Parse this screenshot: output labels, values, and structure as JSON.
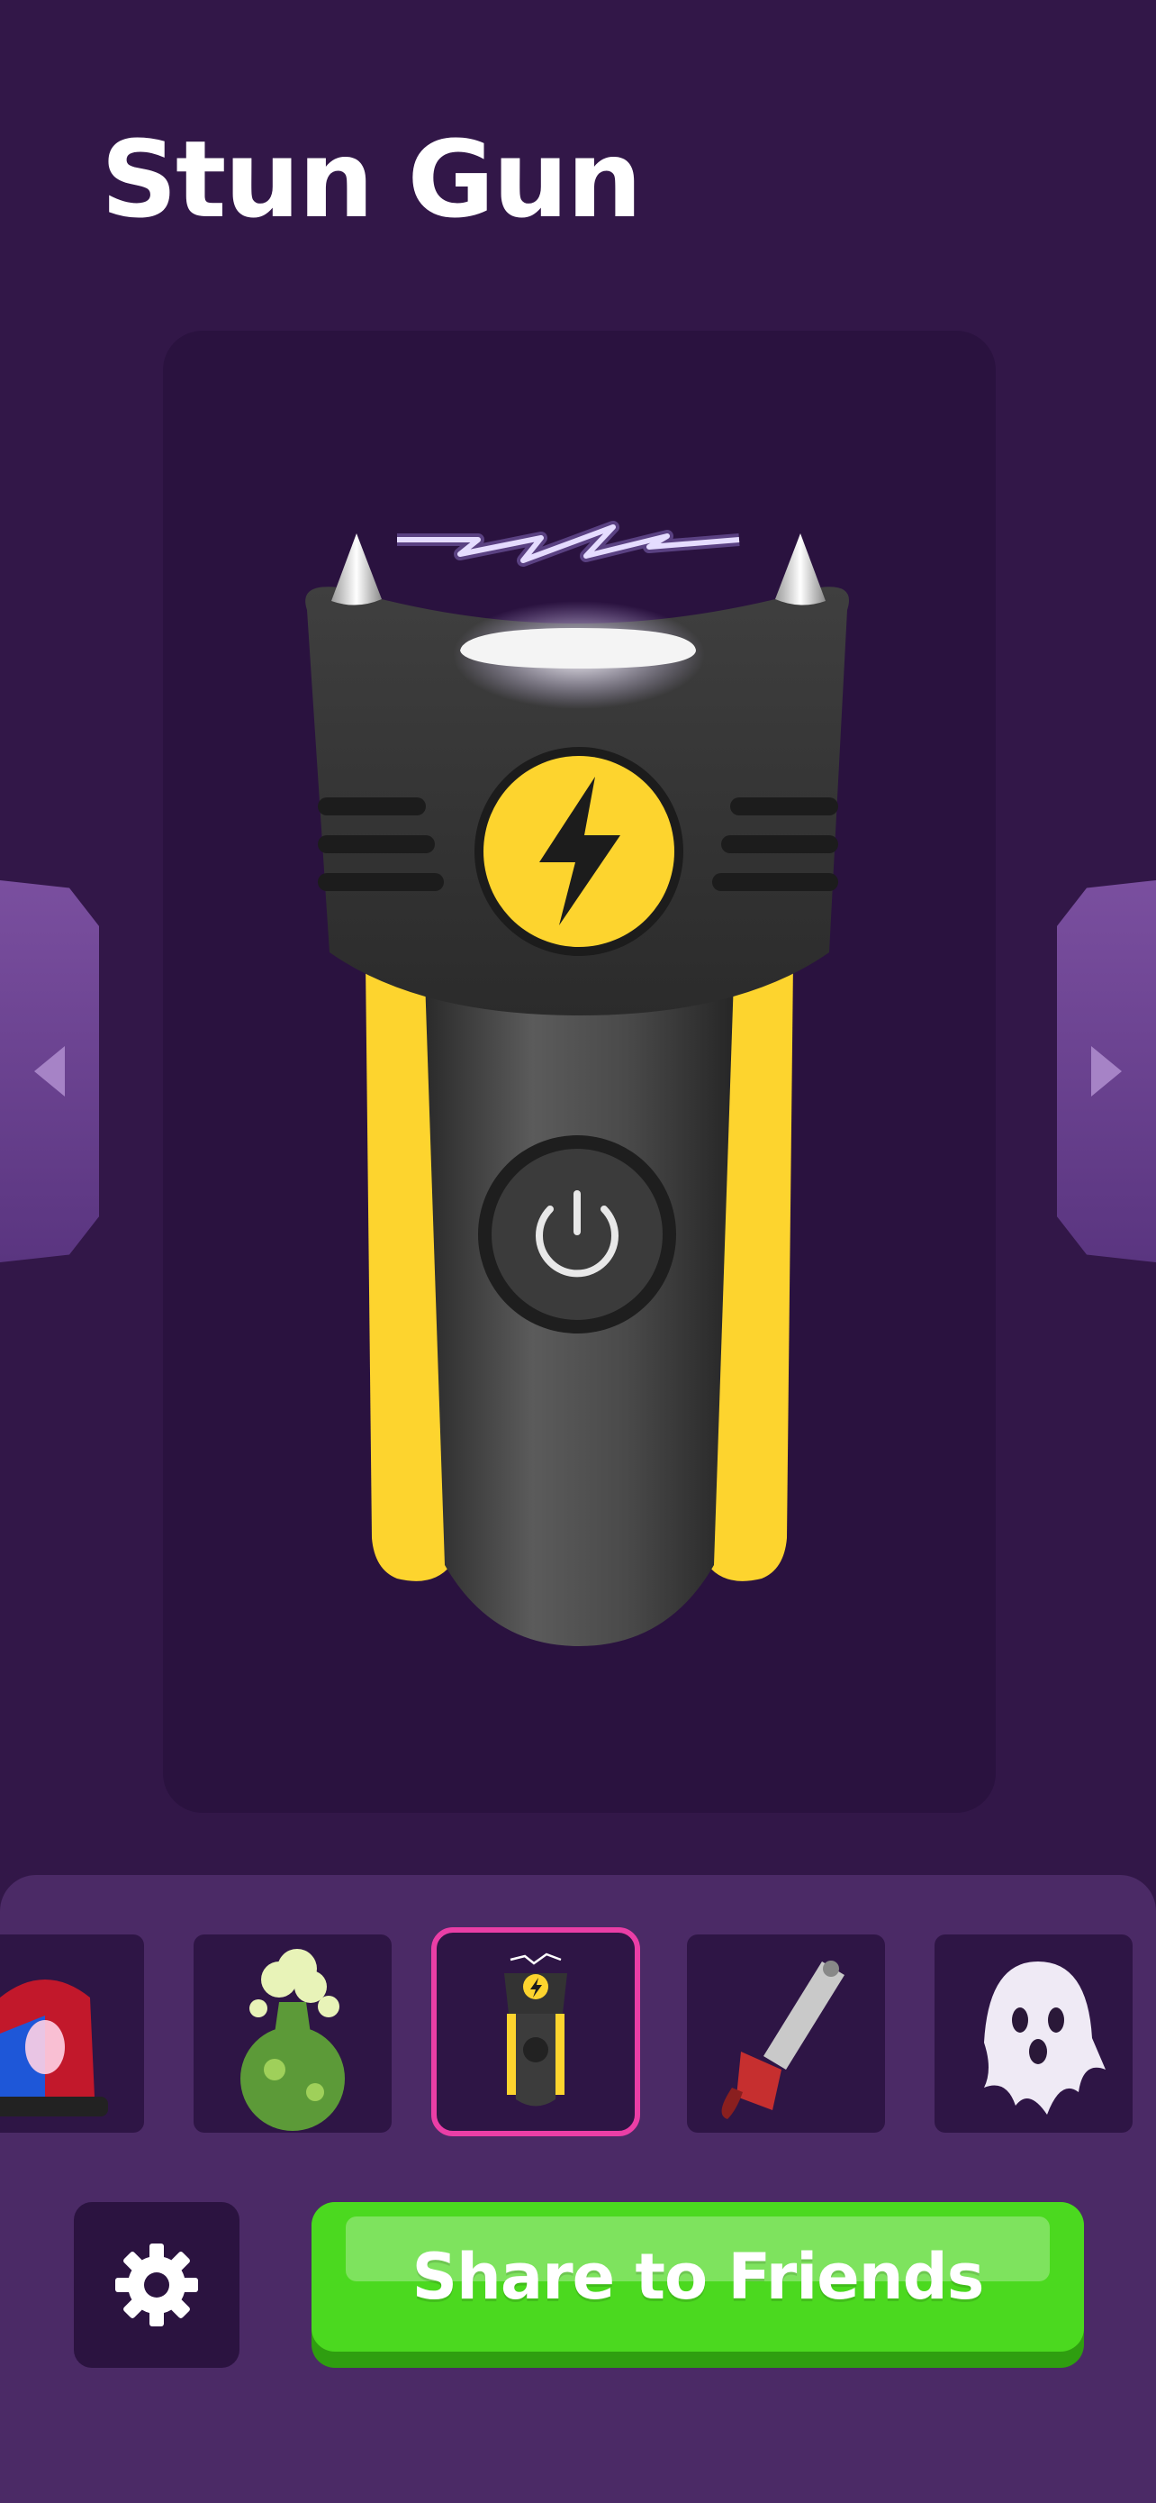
{
  "header": {
    "title": "Stun Gun"
  },
  "device": {
    "name": "stun-gun",
    "colors": {
      "body": "#3a3a3a",
      "accent": "#fdd42e",
      "bolt": "#1c1c1c"
    }
  },
  "thumbnails": [
    {
      "icon": "police-siren-icon",
      "selected": false
    },
    {
      "icon": "fart-cloud-icon",
      "selected": false
    },
    {
      "icon": "stun-gun-icon",
      "selected": true
    },
    {
      "icon": "chainsaw-icon",
      "selected": false
    },
    {
      "icon": "ghost-icon",
      "selected": false
    }
  ],
  "footer": {
    "share_label": "Share to Friends",
    "settings_icon": "gear-icon"
  },
  "colors": {
    "background": "#321748",
    "stage": "#2a123f",
    "tray": "#4b2a66",
    "selected_border": "#ea3ea6",
    "share_green": "#4bd91f"
  }
}
